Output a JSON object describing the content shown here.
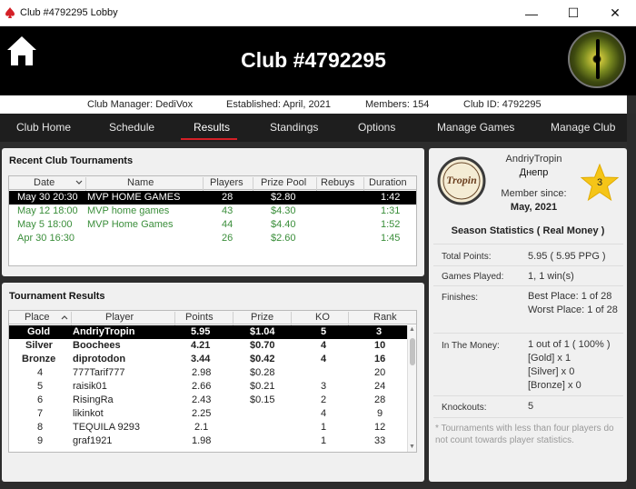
{
  "window": {
    "title": "Club #4792295 Lobby",
    "minimize": "—",
    "maximize": "☐",
    "close": "✕"
  },
  "header": {
    "club_title": "Club #4792295",
    "home_icon": "home-icon",
    "avatar_icon": "dragon-eye-avatar"
  },
  "info": {
    "manager": "Club Manager: DediVox",
    "established": "Established: April, 2021",
    "members": "Members: 154",
    "club_id": "Club ID: 4792295"
  },
  "nav": {
    "tabs": [
      "Club Home",
      "Schedule",
      "Results",
      "Standings",
      "Options",
      "Manage Games",
      "Manage Club"
    ],
    "active": "Results",
    "accent": "#d42027"
  },
  "recent": {
    "title": "Recent Club Tournaments",
    "columns": [
      "Date",
      "Name",
      "Players",
      "Prize Pool",
      "Rebuys",
      "Duration"
    ],
    "rows": [
      {
        "date": "May 30  20:30",
        "name": "MVP HOME GAMES",
        "players": "28",
        "prize": "$2.80",
        "rebuys": "",
        "duration": "1:42"
      },
      {
        "date": "May 12  18:00",
        "name": "MVP home games",
        "players": "43",
        "prize": "$4.30",
        "rebuys": "",
        "duration": "1:31"
      },
      {
        "date": "May 5  18:00",
        "name": "MVP Home Games",
        "players": "44",
        "prize": "$4.40",
        "rebuys": "",
        "duration": "1:52"
      },
      {
        "date": "Apr 30  16:30",
        "name": "",
        "players": "26",
        "prize": "$2.60",
        "rebuys": "",
        "duration": "1:45"
      }
    ]
  },
  "results": {
    "title": "Tournament Results",
    "columns": [
      "Place",
      "Player",
      "Points",
      "Prize",
      "KO",
      "Rank"
    ],
    "rows": [
      {
        "place": "Gold",
        "player": "AndriyTropin",
        "points": "5.95",
        "prize": "$1.04",
        "ko": "5",
        "rank": "3"
      },
      {
        "place": "Silver",
        "player": "Boochees",
        "points": "4.21",
        "prize": "$0.70",
        "ko": "4",
        "rank": "10"
      },
      {
        "place": "Bronze",
        "player": "diprotodon",
        "points": "3.44",
        "prize": "$0.42",
        "ko": "4",
        "rank": "16"
      },
      {
        "place": "4",
        "player": "777Tarif777",
        "points": "2.98",
        "prize": "$0.28",
        "ko": "",
        "rank": "20"
      },
      {
        "place": "5",
        "player": "raisik01",
        "points": "2.66",
        "prize": "$0.21",
        "ko": "3",
        "rank": "24"
      },
      {
        "place": "6",
        "player": "RisingRa",
        "points": "2.43",
        "prize": "$0.15",
        "ko": "2",
        "rank": "28"
      },
      {
        "place": "7",
        "player": "likinkot",
        "points": "2.25",
        "prize": "",
        "ko": "4",
        "rank": "9"
      },
      {
        "place": "8",
        "player": "TEQUILA 9293",
        "points": "2.1",
        "prize": "",
        "ko": "1",
        "rank": "12"
      },
      {
        "place": "9",
        "player": "graf1921",
        "points": "1.98",
        "prize": "",
        "ko": "1",
        "rank": "33"
      }
    ]
  },
  "profile": {
    "logo_text": "Tropin",
    "name": "AndriyTropin",
    "city": "Днепр",
    "member_since_label": "Member since:",
    "member_since": "May, 2021",
    "star_value": "3",
    "star_color": "#f5c518",
    "stats_title": "Season Statistics ( Real Money )",
    "total_points_label": "Total Points:",
    "total_points": "5.95  ( 5.95 PPG )",
    "games_played_label": "Games Played:",
    "games_played": "1, 1 win(s)",
    "finishes_label": "Finishes:",
    "best_place": "Best Place: 1 of 28",
    "worst_place": "Worst Place: 1 of 28",
    "in_money_label": "In The Money:",
    "in_money": "1 out of 1  ( 100% )",
    "gold": "[Gold] x 1",
    "silver": "[Silver] x 0",
    "bronze": "[Bronze] x 0",
    "knockouts_label": "Knockouts:",
    "knockouts": "5",
    "footnote": "* Tournaments with less than four players do not count towards player statistics."
  }
}
